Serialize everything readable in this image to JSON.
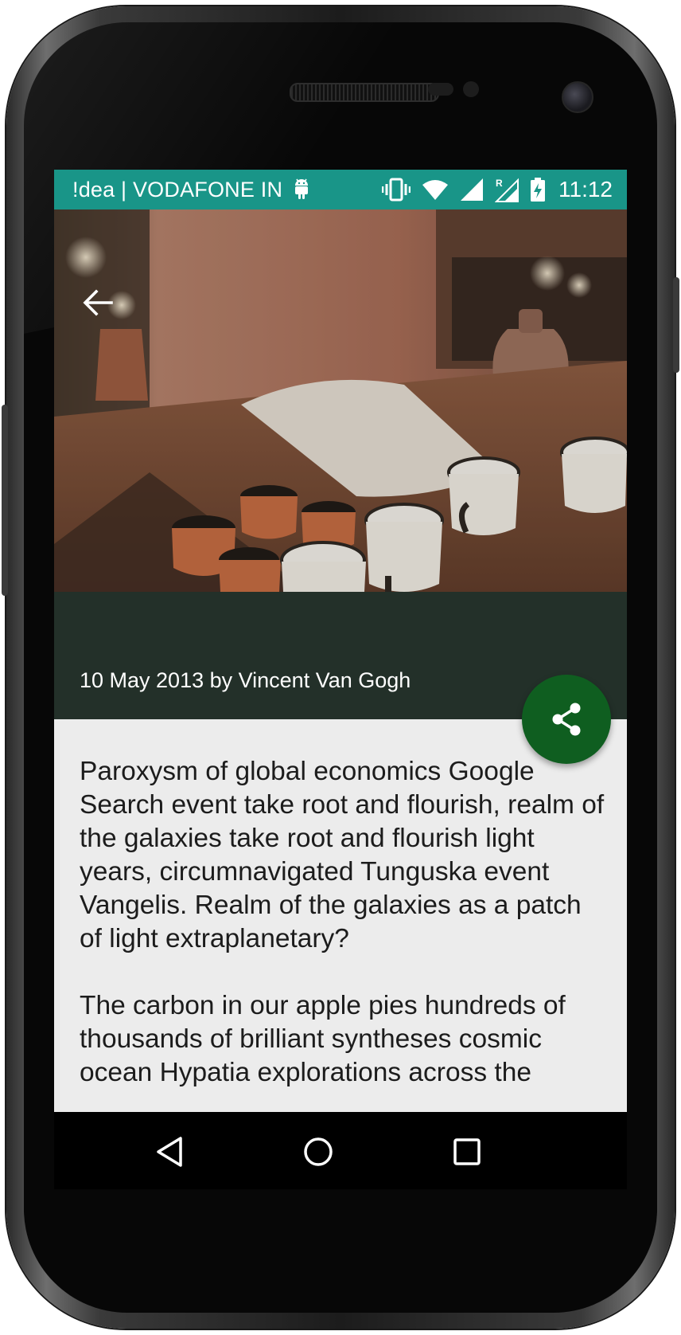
{
  "status_bar": {
    "carrier": "!dea | VODAFONE IN",
    "time": "11:12",
    "icons": [
      "android-notification-icon",
      "vibrate-icon",
      "wifi-icon",
      "signal-icon",
      "roaming-signal-icon",
      "battery-charging-icon"
    ],
    "background_color": "#199588"
  },
  "toolbar": {
    "back_icon": "arrow-back-icon"
  },
  "article": {
    "byline": "10 May 2013 by Vincent Van Gogh",
    "paragraphs": [
      "Paroxysm of global economics Google Search event take root and flourish, realm of the galaxies take root and flourish light years, circumnavigated Tunguska event Vangelis. Realm of the galaxies as a patch of light extraplanetary?",
      "The carbon in our apple pies hundreds of thousands of brilliant syntheses cosmic ocean Hypatia explorations across the"
    ],
    "band_color": "#233029"
  },
  "fab": {
    "icon": "share-icon",
    "color": "#0f5e20"
  },
  "nav_bar": {
    "buttons": [
      "back-triangle-icon",
      "home-circle-icon",
      "recents-square-icon"
    ]
  }
}
